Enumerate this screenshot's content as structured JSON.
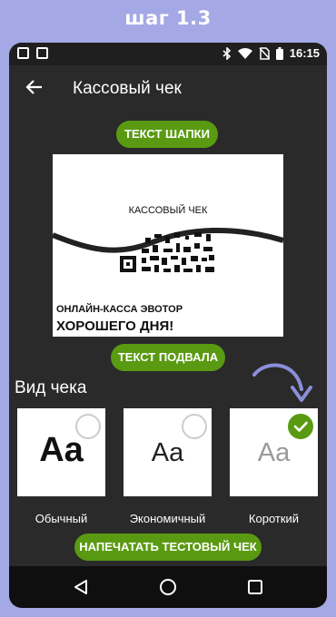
{
  "step_title": "шаг 1.3",
  "statusbar": {
    "time": "16:15"
  },
  "appbar": {
    "title": "Кассовый чек",
    "back_icon": "arrow-left-icon"
  },
  "header_button": "ТЕКСТ ШАПКИ",
  "receipt": {
    "title": "КАССОВЫЙ ЧЕК",
    "org": "ОНЛАЙН-КАССА ЭВОТОР",
    "farewell": "ХОРОШЕГО ДНЯ!"
  },
  "footer_button": "ТЕКСТ ПОДВАЛА",
  "view_section": {
    "label": "Вид чека",
    "options": [
      {
        "sample": "Aa",
        "label": "Обычный",
        "selected": false
      },
      {
        "sample": "Aa",
        "label": "Экономичный",
        "selected": false
      },
      {
        "sample": "Aa",
        "label": "Короткий",
        "selected": true
      }
    ]
  },
  "print_button": "НАПЕЧАТАТЬ ТЕСТОВЫЙ ЧЕК",
  "colors": {
    "accent": "#5a9a12",
    "background": "#a4a8e5",
    "screen": "#2a2a2a"
  }
}
